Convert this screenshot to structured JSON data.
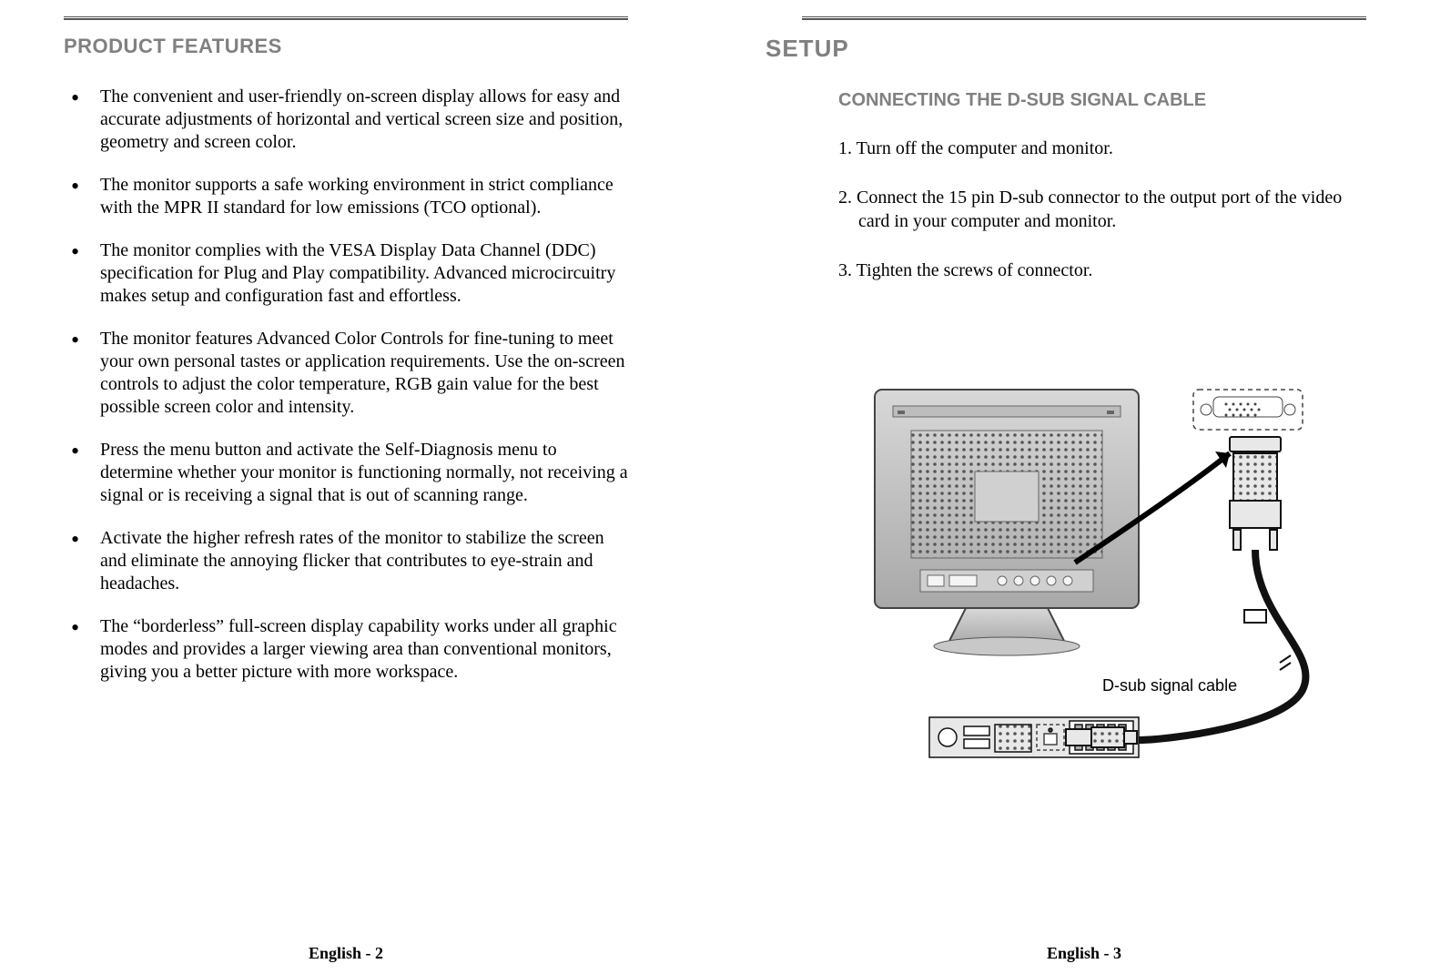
{
  "left": {
    "title": "PRODUCT FEATURES",
    "bullets": [
      "The convenient and user-friendly on-screen display allows for easy and accurate adjustments of horizontal and vertical screen size and position, geometry and screen color.",
      "The monitor supports a safe working environment in strict compliance with the MPR II standard for low emissions (TCO optional).",
      "The monitor complies with the VESA Display Data Channel (DDC) specification for Plug and Play compatibility. Advanced microcircuitry makes setup and configuration fast and effortless.",
      "The monitor features Advanced Color Controls for fine-tuning to meet your own personal tastes or application requirements. Use the on-screen controls to adjust the color temperature, RGB gain value for the best possible screen color and intensity.",
      "Press the menu button and activate the Self-Diagnosis menu to determine whether your monitor is functioning normally, not receiving a signal or is receiving a signal that is out of scanning range.",
      "Activate the higher refresh rates of the monitor to stabilize the screen and eliminate the annoying flicker that contributes to eye-strain and headaches.",
      "The “borderless” full-screen display capability works under all graphic modes and provides a larger viewing area than conventional monitors, giving you a better picture with more workspace."
    ],
    "footer": "English - 2"
  },
  "right": {
    "main_title": "SETUP",
    "sub_title": "CONNECTING THE D-SUB SIGNAL CABLE",
    "steps": [
      "1. Turn off the computer and monitor.",
      "2. Connect the 15 pin D-sub connector to the output port of the video card in your computer and monitor.",
      "3. Tighten the screws of connector."
    ],
    "diagram_label": "D-sub signal cable",
    "footer": "English - 3"
  }
}
